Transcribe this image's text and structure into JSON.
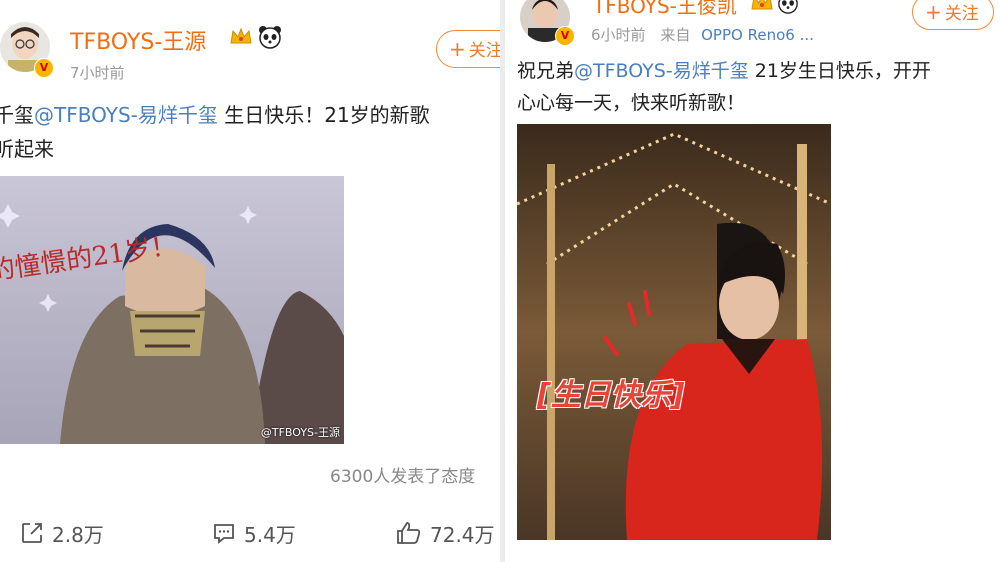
{
  "left_post": {
    "username": "TFBOYS-王源",
    "timestamp": "7小时前",
    "follow_label": "关注",
    "text_line1_prefix": "千玺",
    "text_line1_mention": "@TFBOYS-易烊千玺",
    "text_line1_suffix": " 生日快乐！21岁的新歌",
    "text_line2": "听起来",
    "image_caption": "的憧憬的21岁！",
    "watermark": "@TFBOYS-王源",
    "reactions": "6300人发表了态度",
    "actions": {
      "repost": "2.8万",
      "comment": "5.4万",
      "like": "72.4万"
    }
  },
  "right_post": {
    "username": "TFBOYS-王俊凯",
    "timestamp": "6小时前",
    "source_prefix": "来自",
    "source": "OPPO Reno6 ...",
    "follow_label": "关注",
    "text_line1_prefix": "祝兄弟",
    "text_line1_mention": "@TFBOYS-易烊千玺",
    "text_line1_suffix": " 21岁生日快乐，开开",
    "text_line2": "心心每一天，快来听新歌！",
    "image_caption": "[生日快乐]"
  },
  "colors": {
    "username": "#f26e10",
    "mention": "#4a7fbf",
    "meta": "#9a9a9a",
    "follow": "#f27a2a"
  },
  "icons": [
    "crown-icon",
    "panda-icon",
    "verified-badge-icon",
    "repost-icon",
    "comment-icon",
    "like-icon"
  ]
}
